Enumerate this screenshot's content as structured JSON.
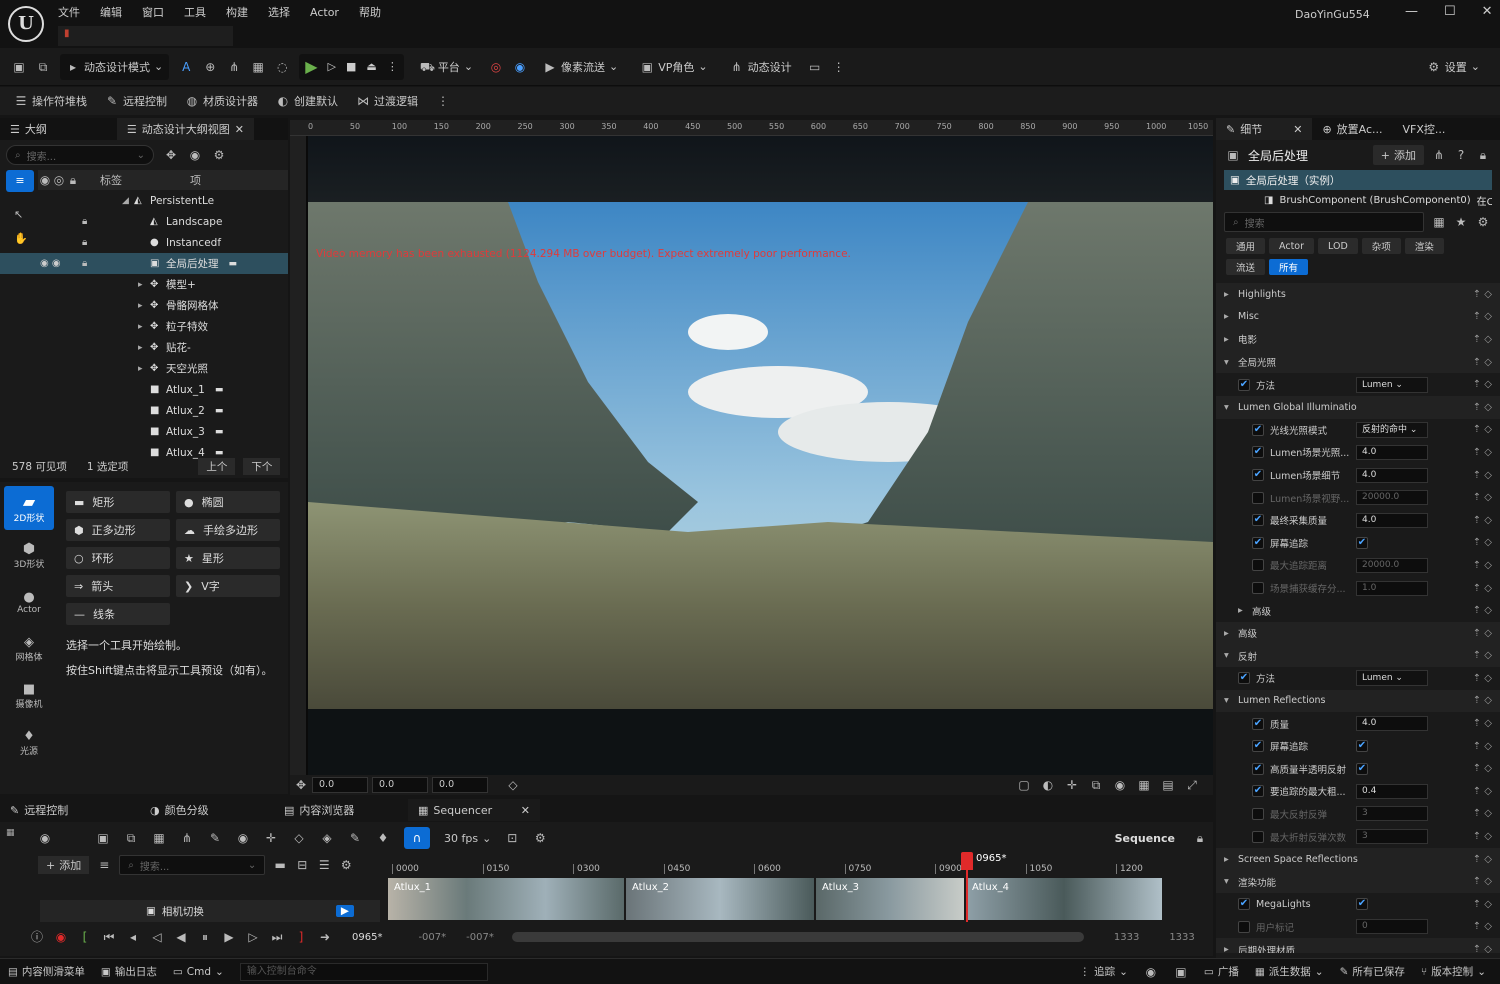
{
  "window": {
    "user": "DaoYinGu554",
    "menu": [
      "文件",
      "编辑",
      "窗口",
      "工具",
      "构建",
      "选择",
      "Actor",
      "帮助"
    ]
  },
  "toolbar": {
    "mode": "动态设计模式",
    "platform": "平台",
    "pixel_streaming": "像素流送",
    "vp_role": "VP角色",
    "motion_design": "动态设计",
    "settings": "设置"
  },
  "toolbar2": [
    "操作符堆栈",
    "远程控制",
    "材质设计器",
    "创建默认",
    "过渡逻辑"
  ],
  "outliner": {
    "tabs": [
      "大纲",
      "动态设计大纲视图"
    ],
    "search_placeholder": "搜索...",
    "col_label": "标签",
    "col_item": "项",
    "rows": [
      "PersistentLe",
      "Landscape",
      "Instancedf",
      "全局后处理",
      "模型+",
      "骨骼网格体",
      "粒子特效",
      "贴花-",
      "天空光照",
      "Atlux_1",
      "Atlux_2",
      "Atlux_3",
      "Atlux_4"
    ],
    "footer": {
      "visible": "578 可见项",
      "selected": "1 选定项",
      "prev": "上个",
      "next": "下个"
    }
  },
  "modes": {
    "categories": [
      "2D形状",
      "3D形状",
      "Actor",
      "网格体",
      "摄像机",
      "光源"
    ],
    "tools": [
      "矩形",
      "椭圆",
      "正多边形",
      "手绘多边形",
      "环形",
      "星形",
      "箭头",
      "V字",
      "线条"
    ],
    "hint1": "选择一个工具开始绘制。",
    "hint2": "按住Shift键点击将显示工具预设（如有）。"
  },
  "viewport": {
    "warning": "Video memory has been exhausted (1124.294 MB over budget). Expect extremely poor performance.",
    "ruler": [
      "0",
      "50",
      "100",
      "150",
      "200",
      "250",
      "300",
      "350",
      "400",
      "450",
      "500",
      "550",
      "600",
      "650",
      "700",
      "750",
      "800",
      "850",
      "900",
      "950",
      "1000",
      "1050"
    ],
    "coords": [
      "0.0",
      "0.0",
      "0.0"
    ]
  },
  "details": {
    "tabs": [
      "细节",
      "放置Ac...",
      "VFX控..."
    ],
    "title": "全局后处理",
    "add": "添加",
    "instance": "全局后处理（实例）",
    "component": "BrushComponent (BrushComponent0)",
    "component_suffix": "在C+",
    "search_placeholder": "搜索",
    "filters": [
      "通用",
      "Actor",
      "LOD",
      "杂项",
      "渲染",
      "流送",
      "所有"
    ],
    "rows": [
      {
        "type": "cat",
        "label": "Highlights"
      },
      {
        "type": "cat",
        "label": "Misc"
      },
      {
        "type": "cat",
        "label": "电影"
      },
      {
        "type": "open",
        "label": "全局光照"
      },
      {
        "type": "dd",
        "label": "方法",
        "value": "Lumen",
        "check": true,
        "level": 1
      },
      {
        "type": "open",
        "label": "Lumen Global Illuminatio"
      },
      {
        "type": "dd",
        "label": "光线光照模式",
        "value": "反射的命中",
        "check": true,
        "level": 2
      },
      {
        "type": "val",
        "label": "Lumen场景光照...",
        "value": "4.0",
        "check": true,
        "level": 2
      },
      {
        "type": "val",
        "label": "Lumen场景细节",
        "value": "4.0",
        "check": true,
        "level": 2
      },
      {
        "type": "val",
        "label": "Lumen场景视野...",
        "value": "20000.0",
        "check": false,
        "level": 2,
        "dim": true
      },
      {
        "type": "val",
        "label": "最终采集质量",
        "value": "4.0",
        "check": true,
        "level": 2
      },
      {
        "type": "box",
        "label": "屏幕追踪",
        "check": true,
        "level": 2
      },
      {
        "type": "val",
        "label": "最大追踪距离",
        "value": "20000.0",
        "check": false,
        "level": 2,
        "dim": true
      },
      {
        "type": "val",
        "label": "场景捕获缓存分...",
        "value": "1.0",
        "check": false,
        "level": 2,
        "dim": true
      },
      {
        "type": "cat",
        "label": "高级",
        "level": 1
      },
      {
        "type": "cat",
        "label": "高级"
      },
      {
        "type": "open",
        "label": "反射"
      },
      {
        "type": "dd",
        "label": "方法",
        "value": "Lumen",
        "check": true,
        "level": 1
      },
      {
        "type": "open",
        "label": "Lumen Reflections"
      },
      {
        "type": "val",
        "label": "质量",
        "value": "4.0",
        "check": true,
        "level": 2
      },
      {
        "type": "box",
        "label": "屏幕追踪",
        "check": true,
        "level": 2
      },
      {
        "type": "box",
        "label": "高质量半透明反射",
        "check": true,
        "level": 2
      },
      {
        "type": "val",
        "label": "要追踪的最大粗...",
        "value": "0.4",
        "check": true,
        "level": 2
      },
      {
        "type": "val",
        "label": "最大反射反弹",
        "value": "3",
        "check": false,
        "level": 2,
        "dim": true
      },
      {
        "type": "val",
        "label": "最大折射反弹次数",
        "value": "3",
        "check": false,
        "level": 2,
        "dim": true
      },
      {
        "type": "cat",
        "label": "Screen Space Reflections"
      },
      {
        "type": "open",
        "label": "渲染功能"
      },
      {
        "type": "box",
        "label": "MegaLights",
        "check": true,
        "level": 1
      },
      {
        "type": "val",
        "label": "用户标记",
        "value": "0",
        "check": false,
        "level": 1,
        "dim": true
      },
      {
        "type": "cat",
        "label": "后期处理材质"
      }
    ]
  },
  "seq_tabs": [
    "远程控制",
    "颜色分级",
    "内容浏览器",
    "Sequencer"
  ],
  "sequencer": {
    "add": "添加",
    "search_placeholder": "搜索...",
    "fps": "30 fps",
    "name": "Sequence",
    "track": "相机切换",
    "frames": [
      "0000",
      "0150",
      "0300",
      "0450",
      "0600",
      "0750",
      "0900",
      "1050",
      "1200"
    ],
    "playhead": "0965*",
    "current": "0965*",
    "start": "-007*",
    "start2": "-007*",
    "end": "1333",
    "end2": "1333",
    "clips": [
      "Atlux_1",
      "Atlux_2",
      "Atlux_3",
      "Atlux_4"
    ]
  },
  "statusbar": {
    "items": [
      "内容侧滑菜单",
      "输出日志",
      "Cmd"
    ],
    "console_placeholder": "输入控制台命令",
    "trace": "追踪",
    "broadcast": "广播",
    "derived": "派生数据",
    "saved": "所有已保存",
    "vcs": "版本控制"
  }
}
